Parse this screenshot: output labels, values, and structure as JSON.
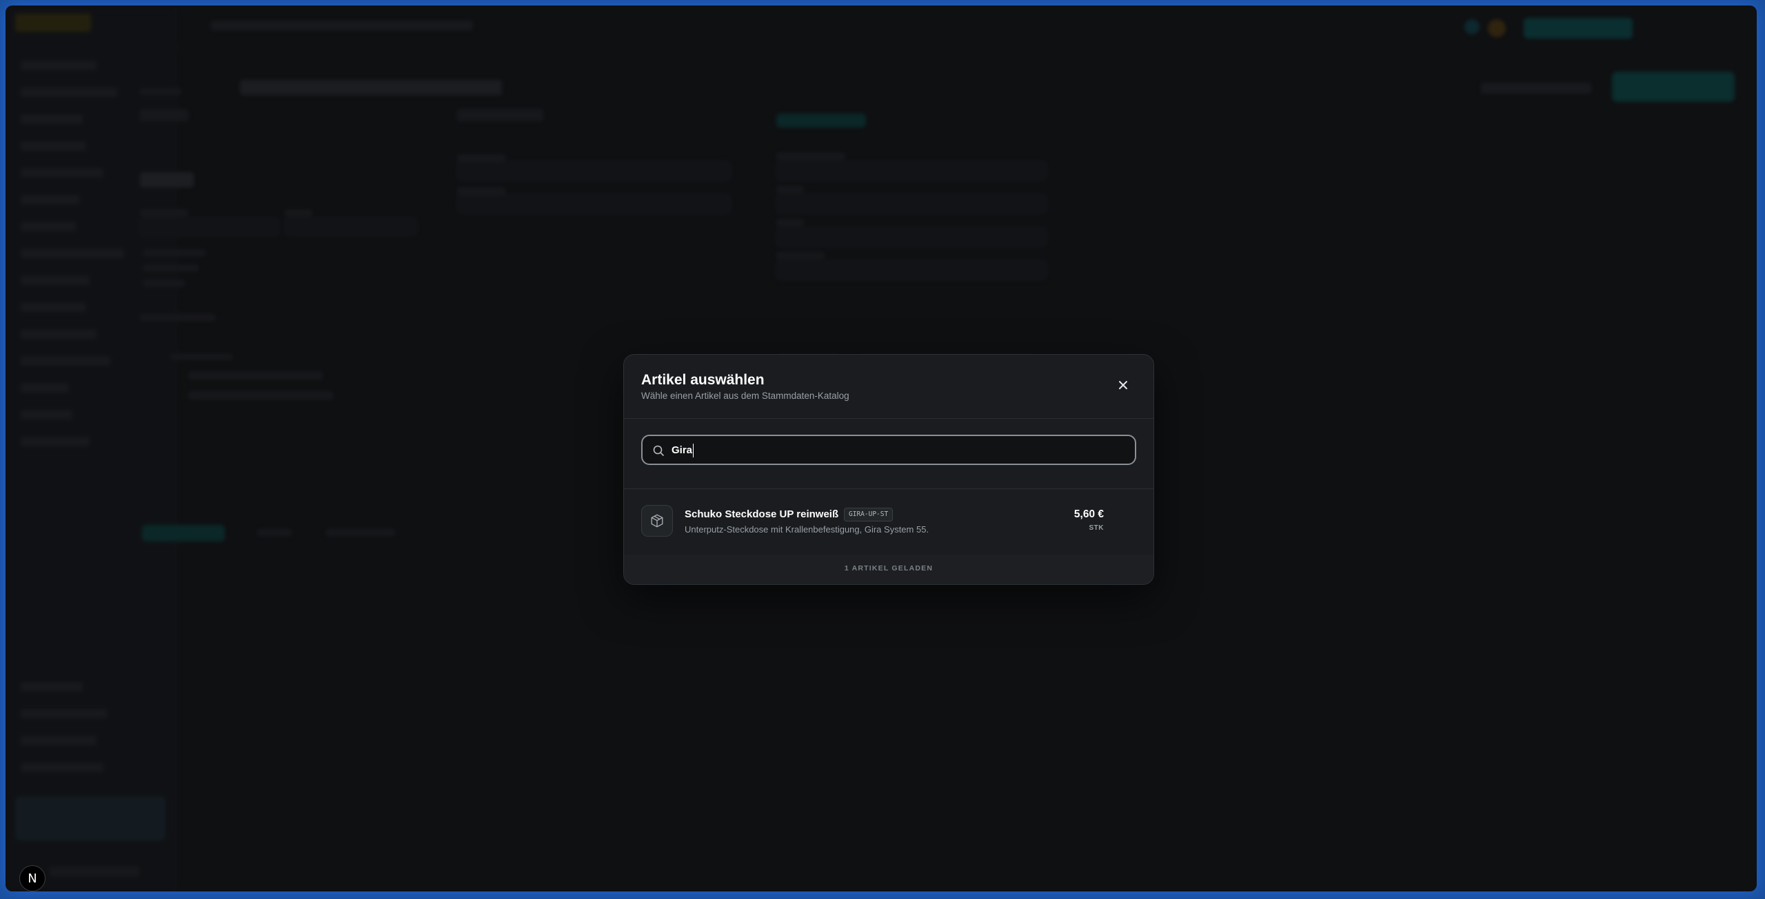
{
  "modal": {
    "title": "Artikel auswählen",
    "subtitle": "Wähle einen Artikel aus dem Stammdaten-Katalog",
    "close_icon": "close-icon"
  },
  "search": {
    "value": "Gira",
    "placeholder": "",
    "icon": "search-icon"
  },
  "results": [
    {
      "icon": "package-icon",
      "name": "Schuko Steckdose UP reinweiß",
      "sku": "GIRA-UP-ST",
      "description": "Unterputz-Steckdose mit Krallenbefestigung, Gira System 55.",
      "price": "5,60 €",
      "unit": "STK"
    }
  ],
  "footer": {
    "count_label": "1 ARTIKEL GELADEN"
  },
  "dev_badge": {
    "label": "N"
  }
}
